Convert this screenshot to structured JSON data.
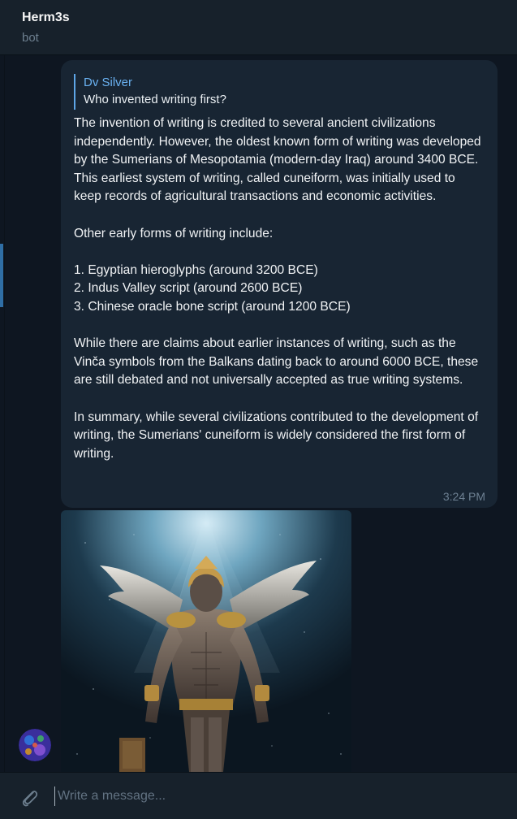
{
  "header": {
    "title": "Herm3s",
    "subtitle": "bot"
  },
  "message": {
    "reply_to": {
      "name": "Dv Silver",
      "text": "Who invented writing first?"
    },
    "text": "The invention of writing is credited to several ancient civilizations independently. However, the oldest known form of writing was developed by the Sumerians of Mesopotamia (modern-day Iraq) around 3400 BCE. This earliest system of writing, called cuneiform, was initially used to keep records of agricultural transactions and economic activities.\n\nOther early forms of writing include:\n\n1. Egyptian hieroglyphs (around 3200 BCE)\n2. Indus Valley script (around 2600 BCE)\n3. Chinese oracle bone script (around 1200 BCE)\n\nWhile there are claims about earlier instances of writing, such as the Vinča symbols from the Balkans dating back to around 6000 BCE, these are still debated and not universally accepted as true writing systems.\n\nIn summary, while several civilizations contributed to the development of writing, the Sumerians' cuneiform is widely considered the first form of writing.",
    "time": "3:24 PM"
  },
  "photo": {
    "subject": "winged-figure-statue"
  },
  "composer": {
    "placeholder": "Write a message...",
    "attach_icon": "paperclip-icon"
  },
  "colors": {
    "background": "#0e1621",
    "panel": "#17212b",
    "bubble": "#182533",
    "accent": "#6ab2f2",
    "muted": "#6d7f8f"
  }
}
